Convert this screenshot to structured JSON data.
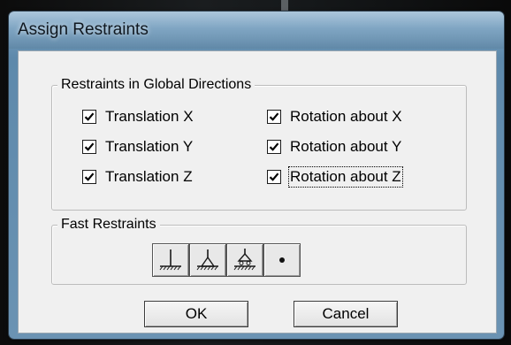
{
  "dialog": {
    "title": "Assign Restraints"
  },
  "global_directions": {
    "label": "Restraints in Global Directions",
    "checkboxes": [
      {
        "label": "Translation X",
        "checked": true
      },
      {
        "label": "Translation Y",
        "checked": true
      },
      {
        "label": "Translation Z",
        "checked": true
      },
      {
        "label": "Rotation about X",
        "checked": true
      },
      {
        "label": "Rotation about Y",
        "checked": true
      },
      {
        "label": "Rotation about Z",
        "checked": true
      }
    ]
  },
  "fast_restraints": {
    "label": "Fast Restraints",
    "buttons": [
      {
        "icon": "fixed-support-icon"
      },
      {
        "icon": "pinned-support-icon"
      },
      {
        "icon": "roller-support-icon"
      },
      {
        "icon": "free-node-icon"
      }
    ]
  },
  "actions": {
    "ok_label": "OK",
    "cancel_label": "Cancel"
  }
}
